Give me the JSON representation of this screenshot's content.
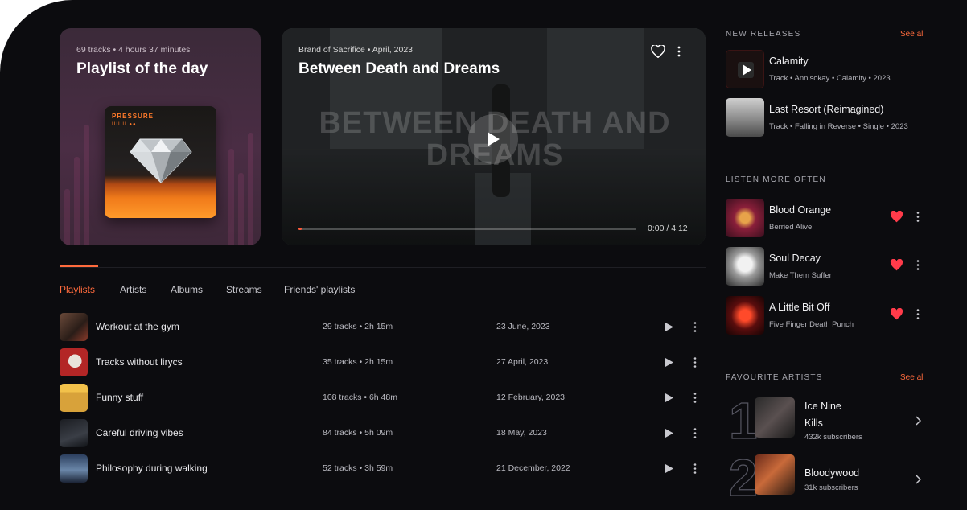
{
  "playlist_of_day": {
    "meta": "69 tracks • 4 hours 37 minutes",
    "title": "Playlist of the day",
    "cover_text_1": "PRESSURE",
    "cover_text_2": "IIIIIII ●●"
  },
  "featured_video": {
    "meta": "Brand of Sacrifice • April, 2023",
    "title": "Between Death and Dreams",
    "overlay_text": "BETWEEN DEATH AND DREAMS",
    "time": "0:00 / 4:12",
    "progress_fraction": 0.01
  },
  "tabs": [
    {
      "label": "Playlists",
      "active": true
    },
    {
      "label": "Artists",
      "active": false
    },
    {
      "label": "Albums",
      "active": false
    },
    {
      "label": "Streams",
      "active": false
    },
    {
      "label": "Friends' playlists",
      "active": false
    }
  ],
  "playlists": [
    {
      "name": "Workout at the gym",
      "tracks": "29 tracks • 2h 15m",
      "date": "23 June, 2023"
    },
    {
      "name": "Tracks without lirycs",
      "tracks": "35 tracks • 2h 15m",
      "date": "27 April, 2023"
    },
    {
      "name": "Funny stuff",
      "tracks": "108 tracks • 6h 48m",
      "date": "12 February, 2023"
    },
    {
      "name": "Careful driving vibes",
      "tracks": "84 tracks • 5h 09m",
      "date": "18 May, 2023"
    },
    {
      "name": "Philosophy during walking",
      "tracks": "52 tracks • 3h 59m",
      "date": "21 December, 2022"
    }
  ],
  "new_releases": {
    "title": "NEW RELEASES",
    "see_all": "See all",
    "items": [
      {
        "title": "Calamity",
        "sub": "Track • Annisokay • Calamity • 2023"
      },
      {
        "title": "Last Resort (Reimagined)",
        "sub": "Track • Falling in Reverse • Single • 2023"
      }
    ]
  },
  "listen_more": {
    "title": "LISTEN MORE OFTEN",
    "items": [
      {
        "title": "Blood Orange",
        "sub": "Berried Alive"
      },
      {
        "title": "Soul Decay",
        "sub": "Make Them Suffer"
      },
      {
        "title": "A Little Bit Off",
        "sub": "Five Finger Death Punch"
      }
    ]
  },
  "favourite_artists": {
    "title": "FAVOURITE ARTISTS",
    "see_all": "See all",
    "items": [
      {
        "rank": "1",
        "name_line1": "Ice Nine",
        "name_line2": "Kills",
        "subs": "432k subscribers"
      },
      {
        "rank": "2",
        "name_line1": "Bloodywood",
        "name_line2": "",
        "subs": "31k subscribers"
      }
    ]
  },
  "colors": {
    "accent": "#ff6b3d",
    "heart": "#ff3b4a",
    "background": "#0c0c0f"
  }
}
